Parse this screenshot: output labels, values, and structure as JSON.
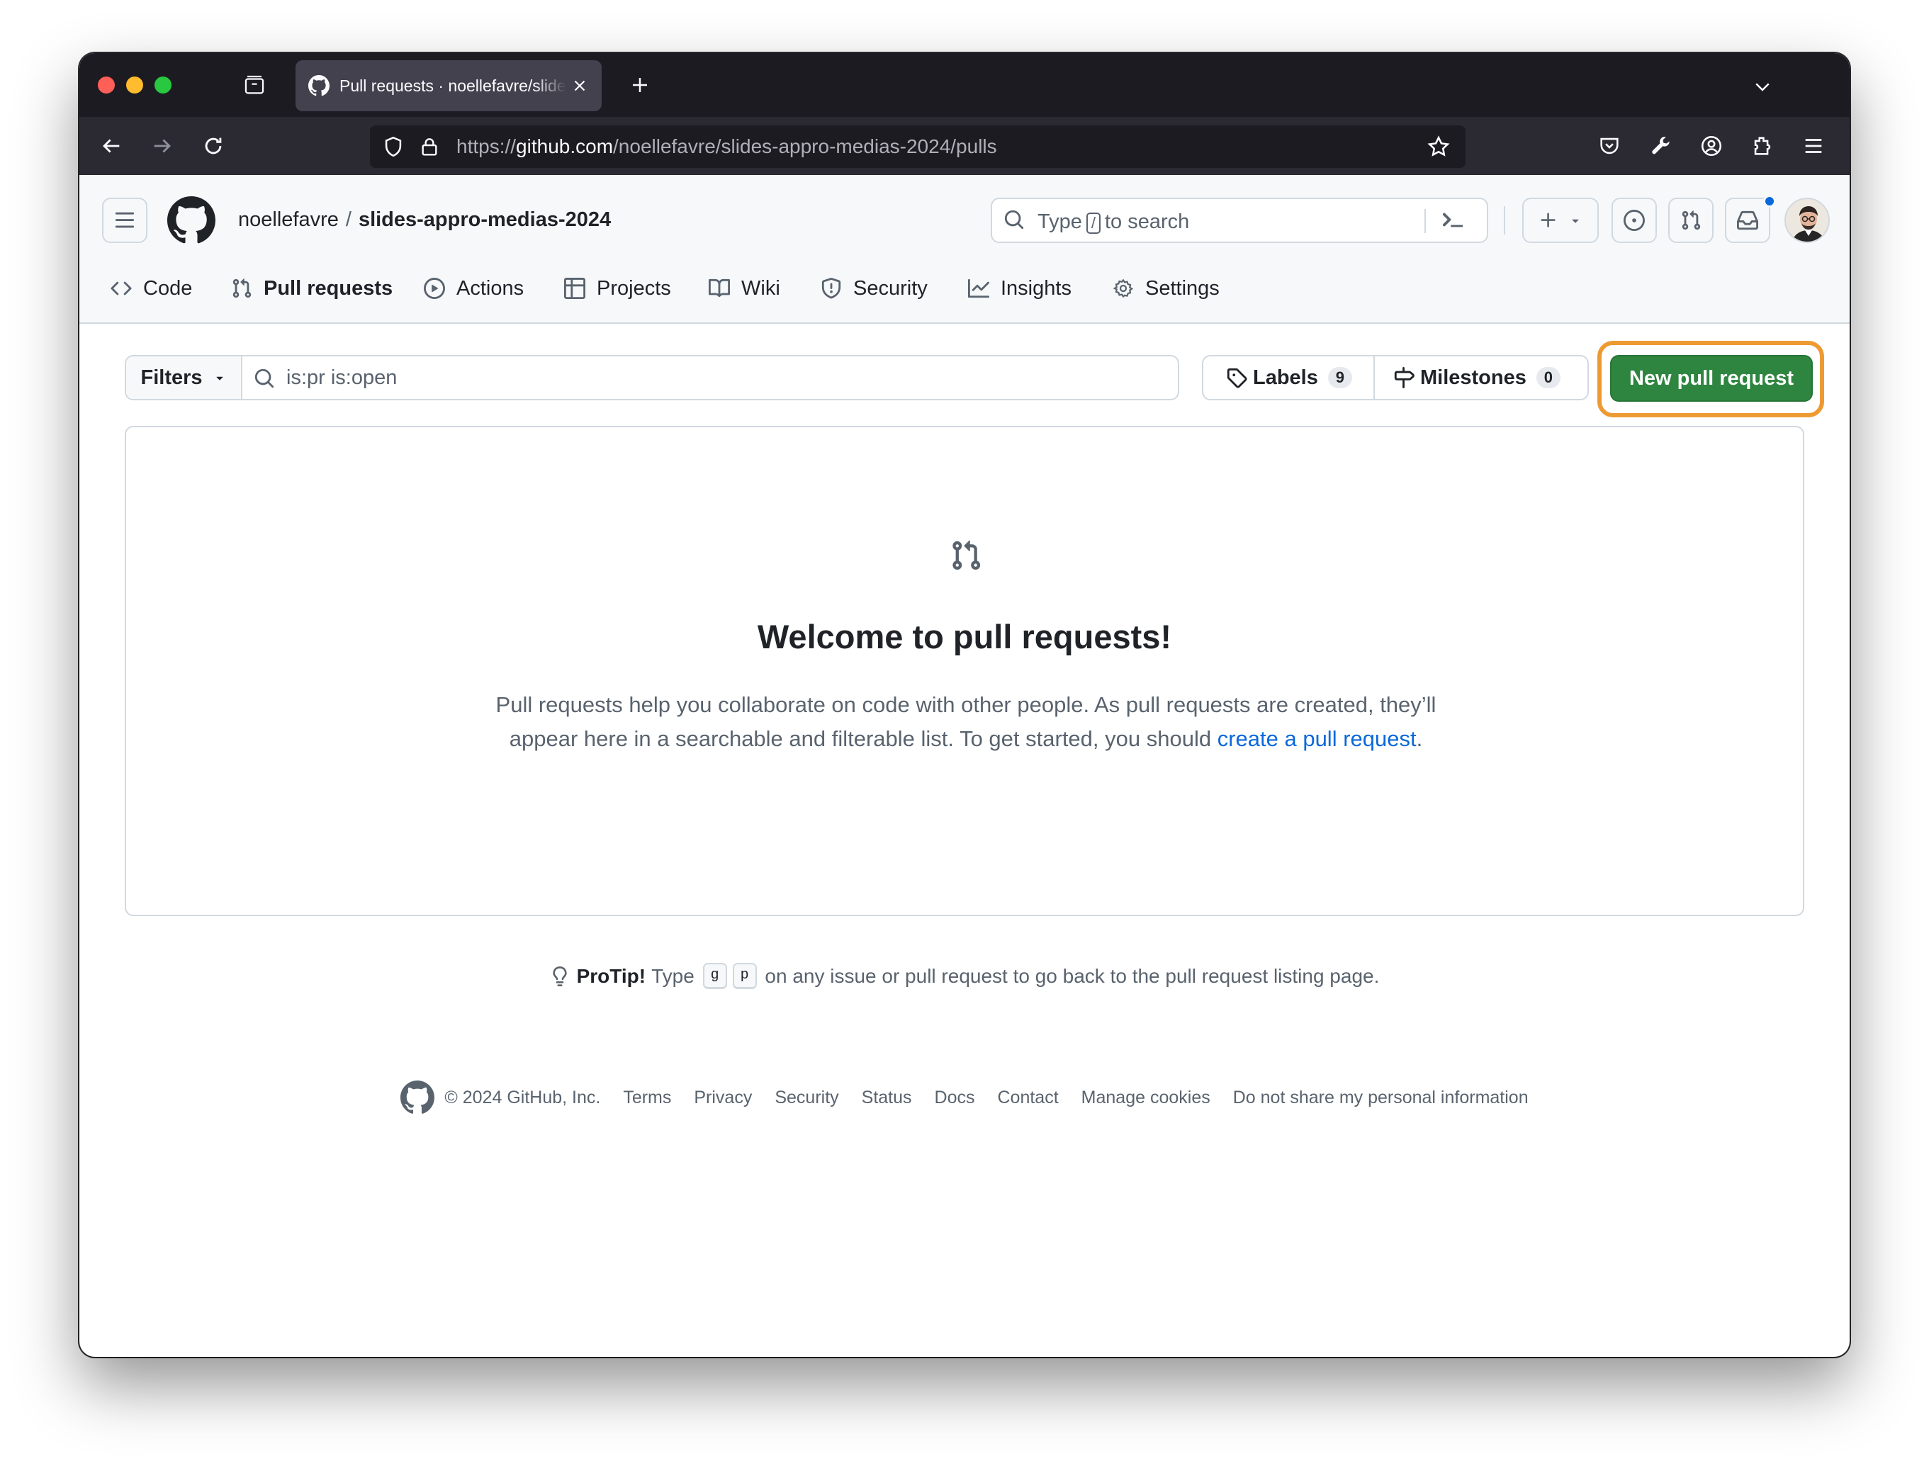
{
  "browser": {
    "tab_title": "Pull requests · noellefavre/slides-appro-medias-2024",
    "url_prefix": "https://",
    "url_host": "github.com",
    "url_path": "/noellefavre/slides-appro-medias-2024/pulls"
  },
  "header": {
    "owner": "noellefavre",
    "separator": "/",
    "repo": "slides-appro-medias-2024",
    "search_before": "Type",
    "search_key": "/",
    "search_after": "to search"
  },
  "repo_nav": [
    {
      "label": "Code",
      "icon": "code-icon"
    },
    {
      "label": "Pull requests",
      "icon": "git-pull-request-icon",
      "active": true
    },
    {
      "label": "Actions",
      "icon": "play-icon"
    },
    {
      "label": "Projects",
      "icon": "table-icon"
    },
    {
      "label": "Wiki",
      "icon": "book-icon"
    },
    {
      "label": "Security",
      "icon": "shield-icon"
    },
    {
      "label": "Insights",
      "icon": "graph-icon"
    },
    {
      "label": "Settings",
      "icon": "gear-icon"
    }
  ],
  "toolbar": {
    "filters_label": "Filters",
    "filter_query": "is:pr is:open",
    "labels_label": "Labels",
    "labels_count": "9",
    "milestones_label": "Milestones",
    "milestones_count": "0",
    "new_pr_label": "New pull request"
  },
  "blankslate": {
    "title": "Welcome to pull requests!",
    "description": "Pull requests help you collaborate on code with other people. As pull requests are created, they’ll appear here in a searchable and filterable list. To get started, you should ",
    "link_text": "create a pull request",
    "trailing": "."
  },
  "protip": {
    "label": "ProTip!",
    "before": "Type",
    "key1": "g",
    "key2": "p",
    "after": "on any issue or pull request to go back to the pull request listing page."
  },
  "footer": {
    "copyright": "© 2024 GitHub, Inc.",
    "links": [
      "Terms",
      "Privacy",
      "Security",
      "Status",
      "Docs",
      "Contact",
      "Manage cookies",
      "Do not share my personal information"
    ]
  },
  "colors": {
    "accent_green": "#2e8540",
    "highlight_orange": "#ee9a33",
    "active_tab_underline": "#fd8c73",
    "link_blue": "#0969da",
    "notification_dot": "#0969da"
  }
}
